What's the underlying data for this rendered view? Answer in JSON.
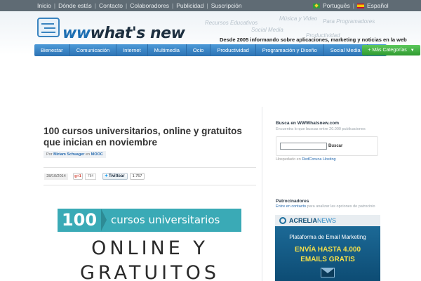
{
  "topbar": {
    "links": [
      "Inicio",
      "Dónde estás",
      "Contacto",
      "Colaboradores",
      "Publicidad",
      "Suscripción"
    ],
    "lang_pt": "Português",
    "lang_es": "Español"
  },
  "header": {
    "logo_prefix": "ww",
    "logo_rest": "what's new",
    "tag_cloud": [
      "Música y Video",
      "Recursos Educativos",
      "Para Programadores",
      "Social Media",
      "Productividad"
    ],
    "tagline": "Desde 2005 informando sobre aplicaciones, marketing y noticias en la web"
  },
  "nav": {
    "items": [
      "Bienestar",
      "Comunicación",
      "Internet",
      "Multimedia",
      "Ocio",
      "Productividad",
      "Programación y Diseño",
      "Social Media"
    ],
    "more_label": "+ Más Categorías"
  },
  "article": {
    "title": "100 cursos universitarios, online y gratuitos que inician en noviembre",
    "by_prefix": "Por",
    "author": "Miriam Schuager",
    "in_word": "en",
    "category": "MOOC",
    "date": "28/10/2014",
    "gplus_label": "g+1",
    "gplus_count": "784",
    "tweet_label": "Twittear",
    "tweet_count": "1.757",
    "hero_number": "100",
    "hero_banner_text": "cursos universitarios",
    "hero_line1": "ONLINE Y",
    "hero_line2": "GRATUITOS"
  },
  "sidebar": {
    "search_title": "Busca en WWWhatsnew.com",
    "search_sub": "Encuentra lo que buscas entre 20.000 publicaciones",
    "search_button": "Buscar",
    "search_value": "",
    "hosted_prefix": "Hospedado en",
    "hosted_link": "RedCoruna Hosting",
    "sponsors_title": "Patrocinadores",
    "sponsors_link": "Entre en contacto",
    "sponsors_rest": "para analizar las opciones de patrocinio",
    "ad_brand": "ACRELIA",
    "ad_brand_suffix": "NEWS",
    "ad_line1": "Plataforma de Email Marketing",
    "ad_line2": "ENVÍA HASTA 4.000",
    "ad_line3": "EMAILS GRATIS"
  },
  "colors": {
    "nav_blue": "#2c72b3",
    "more_green": "#2f9a2f",
    "banner_teal": "#3aaab6",
    "link_blue": "#2a6db0"
  }
}
